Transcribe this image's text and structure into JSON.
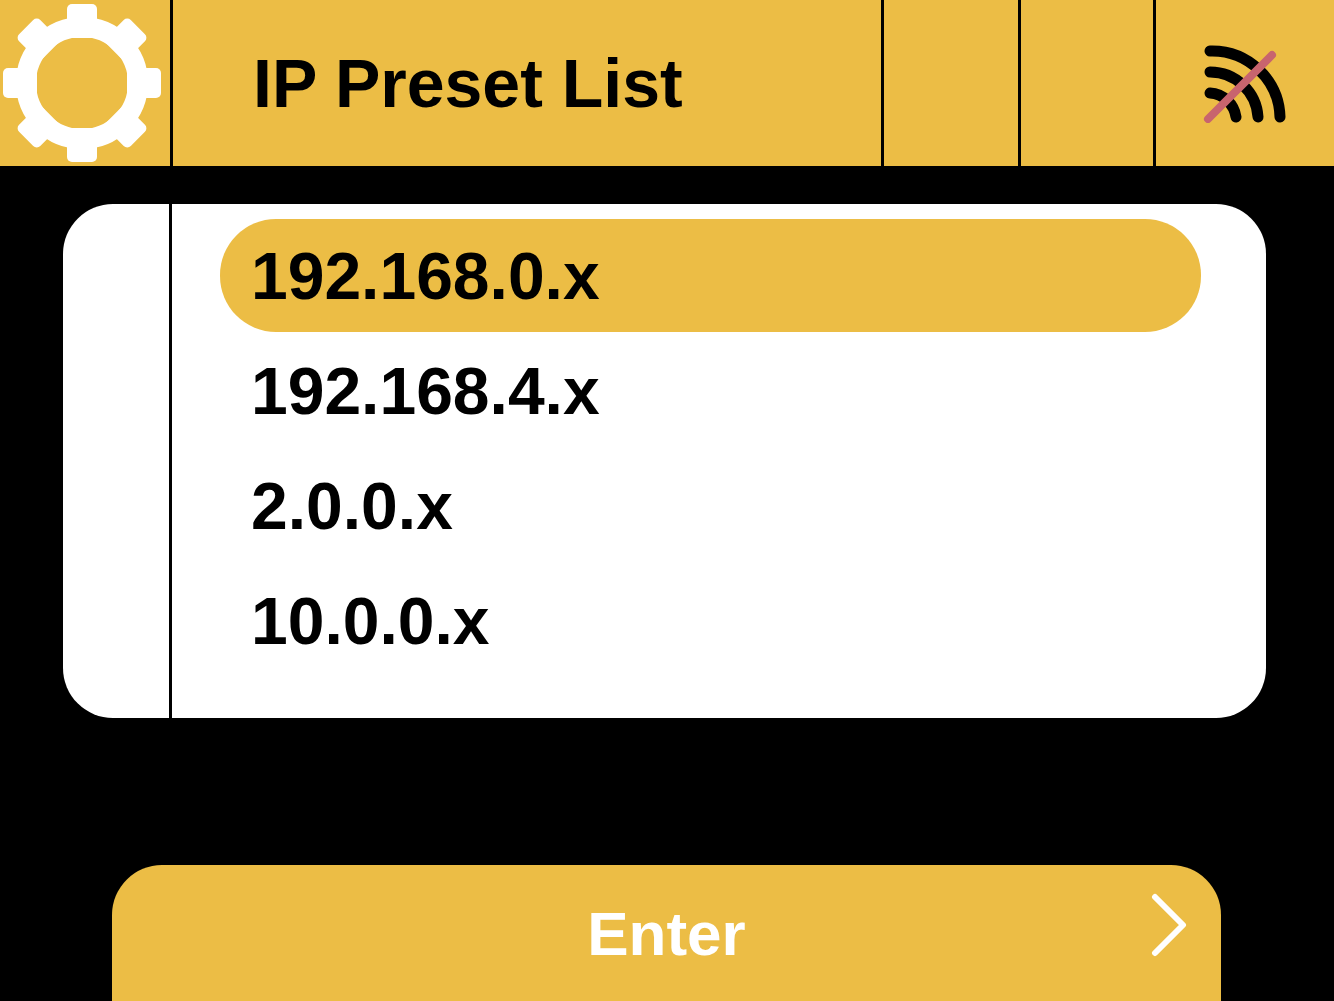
{
  "header": {
    "title": "IP Preset List",
    "connected": false
  },
  "presets": [
    {
      "label": "192.168.0.x",
      "selected": true
    },
    {
      "label": "192.168.4.x",
      "selected": false
    },
    {
      "label": "2.0.0.x",
      "selected": false
    },
    {
      "label": "10.0.0.x",
      "selected": false
    }
  ],
  "enter_button": {
    "label": "Enter"
  }
}
